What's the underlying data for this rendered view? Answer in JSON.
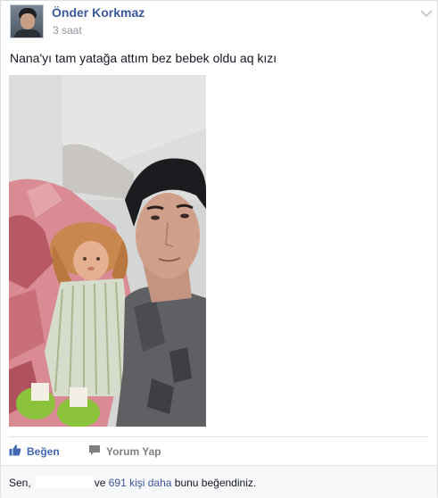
{
  "post": {
    "author_name": "Önder Korkmaz",
    "timestamp": "3 saat",
    "text": "Nana'yı tam yatağa attım bez bebek oldu aq kızı"
  },
  "actions": {
    "like_label": "Beğen",
    "comment_label": "Yorum Yap"
  },
  "likes": {
    "prefix": "Sen,",
    "conjunction": "ve",
    "others_link": "691 kişi daha",
    "suffix": "bunu beğendiniz."
  },
  "colors": {
    "link_blue": "#3b5998",
    "action_blue": "#4267b2",
    "muted_gray": "#90949c"
  },
  "icons": {
    "like": "thumbs-up-icon",
    "comment": "speech-bubble-icon",
    "menu": "chevron-down-icon"
  }
}
